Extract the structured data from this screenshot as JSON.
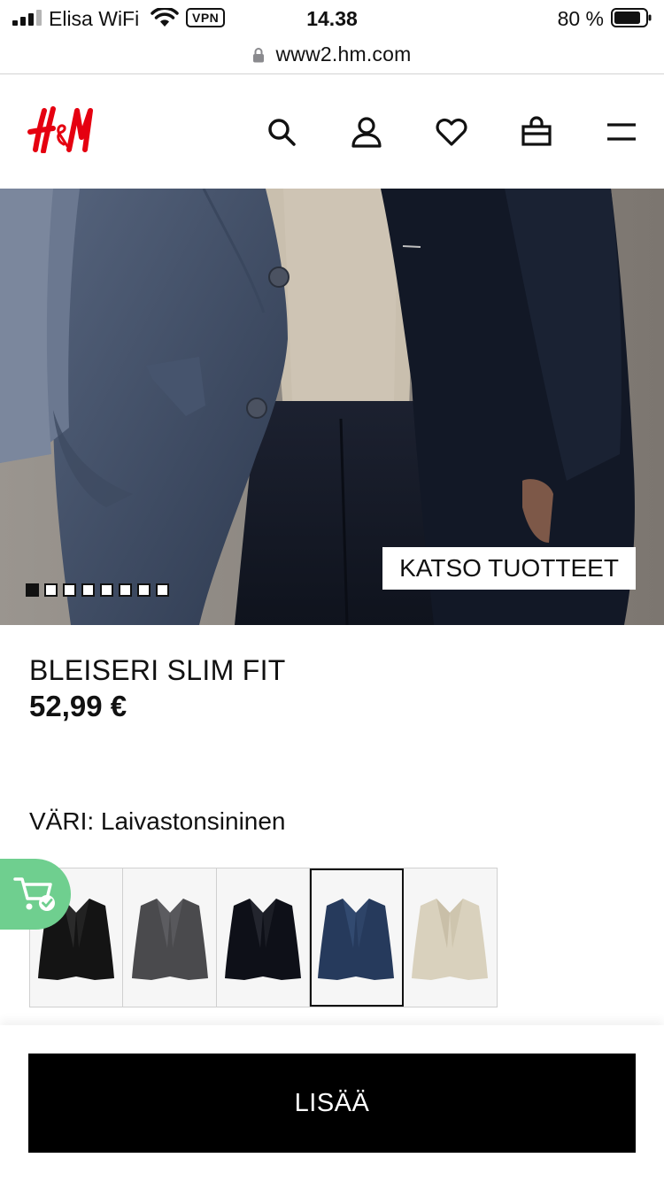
{
  "status_bar": {
    "carrier": "Elisa WiFi",
    "vpn": "VPN",
    "time": "14.38",
    "battery": "80 %"
  },
  "browser": {
    "url": "www2.hm.com"
  },
  "header": {
    "logo_text": "H&M",
    "icons": [
      "search-icon",
      "account-icon",
      "heart-icon",
      "bag-icon",
      "menu-icon"
    ]
  },
  "hero": {
    "cta_label": "KATSO TUOTTEET",
    "slide_count": 8,
    "active_slide": 1
  },
  "product": {
    "name": "BLEISERI SLIM FIT",
    "price": "52,99 €",
    "color_label": "VÄRI: Laivastonsininen"
  },
  "swatches": [
    {
      "color": "#141414",
      "selected": false
    },
    {
      "color": "#4a4a4d",
      "selected": false
    },
    {
      "color": "#0e1018",
      "selected": false
    },
    {
      "color": "#263a5c",
      "selected": true
    },
    {
      "color": "#d9d1bd",
      "selected": false
    }
  ],
  "cart_badge": {
    "color": "#6fcf8f"
  },
  "actions": {
    "add_label": "LISÄÄ"
  }
}
